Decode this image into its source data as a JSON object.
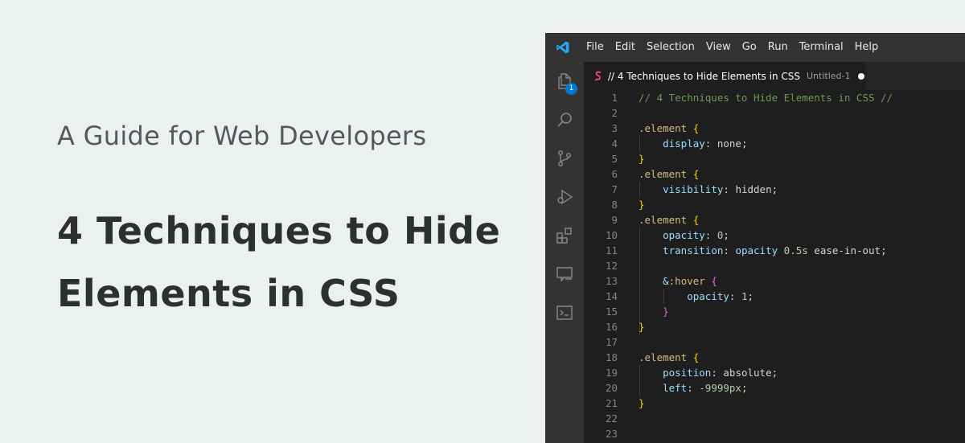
{
  "hero": {
    "subtitle": "A Guide for Web Developers",
    "title_line1": "4 Techniques to Hide",
    "title_line2": "Elements in CSS"
  },
  "editor": {
    "menu": [
      "File",
      "Edit",
      "Selection",
      "View",
      "Go",
      "Run",
      "Terminal",
      "Help"
    ],
    "activity_icons": [
      "explorer-icon",
      "search-icon",
      "source-control-icon",
      "run-debug-icon",
      "extensions-icon",
      "remote-explorer-icon",
      "terminal-icon"
    ],
    "explorer_badge": "1",
    "tab": {
      "title": "// 4 Techniques to Hide Elements in CSS",
      "description": "Untitled-1",
      "dirty": true
    },
    "lines": [
      {
        "n": "1",
        "t": [
          [
            "c-comment",
            "// 4 Techniques to Hide Elements in CSS //"
          ]
        ]
      },
      {
        "n": "2",
        "t": []
      },
      {
        "n": "3",
        "t": [
          [
            "c-sel",
            ".element"
          ],
          [
            "c-punc",
            " "
          ],
          [
            "c-brace",
            "{"
          ]
        ]
      },
      {
        "n": "4",
        "t": [
          [
            "c-punc",
            "    "
          ],
          [
            "c-prop",
            "display"
          ],
          [
            "c-punc",
            ": "
          ],
          [
            "c-val",
            "none"
          ],
          [
            "c-punc",
            ";"
          ]
        ]
      },
      {
        "n": "5",
        "t": [
          [
            "c-brace",
            "}"
          ]
        ]
      },
      {
        "n": "6",
        "t": [
          [
            "c-sel",
            ".element"
          ],
          [
            "c-punc",
            " "
          ],
          [
            "c-brace",
            "{"
          ]
        ]
      },
      {
        "n": "7",
        "t": [
          [
            "c-punc",
            "    "
          ],
          [
            "c-prop",
            "visibility"
          ],
          [
            "c-punc",
            ": "
          ],
          [
            "c-val",
            "hidden"
          ],
          [
            "c-punc",
            ";"
          ]
        ]
      },
      {
        "n": "8",
        "t": [
          [
            "c-brace",
            "}"
          ]
        ]
      },
      {
        "n": "9",
        "t": [
          [
            "c-sel",
            ".element"
          ],
          [
            "c-punc",
            " "
          ],
          [
            "c-brace",
            "{"
          ]
        ]
      },
      {
        "n": "10",
        "t": [
          [
            "c-punc",
            "    "
          ],
          [
            "c-prop",
            "opacity"
          ],
          [
            "c-punc",
            ": "
          ],
          [
            "c-num",
            "0"
          ],
          [
            "c-punc",
            ";"
          ]
        ]
      },
      {
        "n": "11",
        "t": [
          [
            "c-punc",
            "    "
          ],
          [
            "c-prop",
            "transition"
          ],
          [
            "c-punc",
            ": "
          ],
          [
            "c-prop",
            "opacity"
          ],
          [
            "c-punc",
            " "
          ],
          [
            "c-num",
            "0.5s"
          ],
          [
            "c-punc",
            " "
          ],
          [
            "c-val",
            "ease-in-out"
          ],
          [
            "c-punc",
            ";"
          ]
        ]
      },
      {
        "n": "12",
        "t": []
      },
      {
        "n": "13",
        "t": [
          [
            "c-punc",
            "    "
          ],
          [
            "c-prop",
            "&"
          ],
          [
            "c-sel",
            ":hover"
          ],
          [
            "c-punc",
            " "
          ],
          [
            "c-brace2",
            "{"
          ]
        ]
      },
      {
        "n": "14",
        "t": [
          [
            "c-punc",
            "        "
          ],
          [
            "c-prop",
            "opacity"
          ],
          [
            "c-punc",
            ": "
          ],
          [
            "c-num",
            "1"
          ],
          [
            "c-punc",
            ";"
          ]
        ]
      },
      {
        "n": "15",
        "t": [
          [
            "c-punc",
            "    "
          ],
          [
            "c-brace2",
            "}"
          ]
        ]
      },
      {
        "n": "16",
        "t": [
          [
            "c-brace",
            "}"
          ]
        ]
      },
      {
        "n": "17",
        "t": []
      },
      {
        "n": "18",
        "t": [
          [
            "c-sel",
            ".element"
          ],
          [
            "c-punc",
            " "
          ],
          [
            "c-brace",
            "{"
          ]
        ]
      },
      {
        "n": "19",
        "t": [
          [
            "c-punc",
            "    "
          ],
          [
            "c-prop",
            "position"
          ],
          [
            "c-punc",
            ": "
          ],
          [
            "c-val",
            "absolute"
          ],
          [
            "c-punc",
            ";"
          ]
        ]
      },
      {
        "n": "20",
        "t": [
          [
            "c-punc",
            "    "
          ],
          [
            "c-prop",
            "left"
          ],
          [
            "c-punc",
            ": "
          ],
          [
            "c-num",
            "-9999px"
          ],
          [
            "c-punc",
            ";"
          ]
        ]
      },
      {
        "n": "21",
        "t": [
          [
            "c-brace",
            "}"
          ]
        ]
      },
      {
        "n": "22",
        "t": []
      },
      {
        "n": "23",
        "t": []
      }
    ]
  },
  "colors": {
    "background": "#ecf0f0",
    "editor_bg": "#1e1e1e",
    "chrome_bg": "#333333",
    "accent": "#007acc"
  }
}
